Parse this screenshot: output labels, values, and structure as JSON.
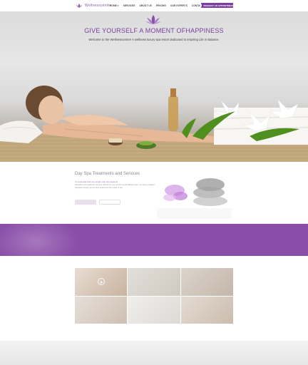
{
  "header": {
    "logo_text": "Wellnesscenter",
    "nav": [
      {
        "label": "HOME",
        "has_dropdown": true
      },
      {
        "label": "SERVICES",
        "has_dropdown": false
      },
      {
        "label": "ABOUT US",
        "has_dropdown": false
      },
      {
        "label": "PRICING",
        "has_dropdown": false
      },
      {
        "label": "OUR EXPERTS",
        "has_dropdown": false
      },
      {
        "label": "CONTACT",
        "has_dropdown": false
      },
      {
        "label": "SHOW MORE",
        "has_dropdown": true
      }
    ],
    "appointment_button": "REQUEST AN APPOINTMENT",
    "appointment_icon": "calendar-icon"
  },
  "hero": {
    "title": "GIVE YOURSELF A MOMENT OFHAPPINESS",
    "subtitle": "Welcome to the Wellnesscenter! A wellness luxury spa resort dedicated to inspiring Life in Balance.",
    "accent_color": "#7a3d9c"
  },
  "services": {
    "title": "Day Spa Treatments and Services",
    "lead": "An essential and one single stop spa aspects.",
    "body": "Relaxation and wellness services offered for your comfort at affordable prices. Our team of skilled therapists brings you the best treatments from head to toe."
  },
  "colors": {
    "brand_purple": "#7b3e9e",
    "band_purple": "#8a4ea8"
  }
}
